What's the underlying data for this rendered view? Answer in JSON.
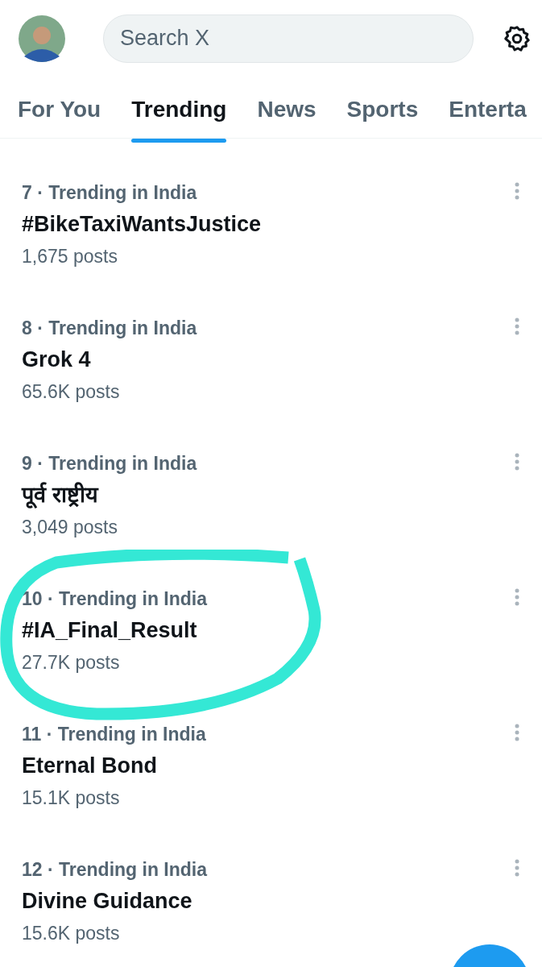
{
  "search": {
    "placeholder": "Search X"
  },
  "tabs": [
    {
      "label": "For You",
      "selected": false
    },
    {
      "label": "Trending",
      "selected": true
    },
    {
      "label": "News",
      "selected": false
    },
    {
      "label": "Sports",
      "selected": false
    },
    {
      "label": "Enterta",
      "selected": false
    }
  ],
  "trends": [
    {
      "meta": "7 · Trending in India",
      "title": "#BikeTaxiWantsJustice",
      "posts": "1,675 posts",
      "highlighted": false
    },
    {
      "meta": "8 · Trending in India",
      "title": "Grok 4",
      "posts": "65.6K posts",
      "highlighted": false
    },
    {
      "meta": "9 · Trending in India",
      "title": "पूर्व राष्ट्रीय",
      "posts": "3,049 posts",
      "highlighted": false
    },
    {
      "meta": "10 · Trending in India",
      "title": "#IA_Final_Result",
      "posts": "27.7K posts",
      "highlighted": true
    },
    {
      "meta": "11 · Trending in India",
      "title": "Eternal Bond",
      "posts": "15.1K posts",
      "highlighted": false
    },
    {
      "meta": "12 · Trending in India",
      "title": "Divine Guidance",
      "posts": "15.6K posts",
      "highlighted": false
    }
  ]
}
